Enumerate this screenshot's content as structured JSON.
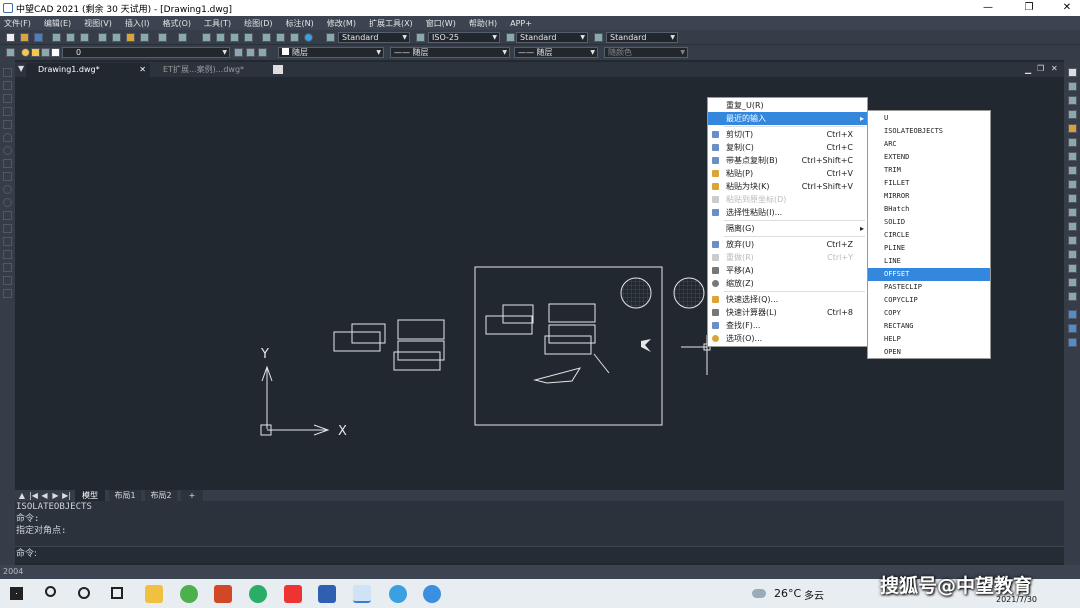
{
  "window": {
    "title": "中望CAD 2021 (剩余 30 天试用) - [Drawing1.dwg]"
  },
  "menu": [
    "文件(F)",
    "编辑(E)",
    "视图(V)",
    "插入(I)",
    "格式(O)",
    "工具(T)",
    "绘图(D)",
    "标注(N)",
    "修改(M)",
    "扩展工具(X)",
    "窗口(W)",
    "帮助(H)",
    "APP+"
  ],
  "toolbar": {
    "text_style": "Standard",
    "dim_style": "ISO-25",
    "table_style": "Standard",
    "multileader_style": "Standard",
    "layer": "0",
    "color": "随层",
    "linetype": "—— 随层",
    "lineweight": "—— 随层",
    "plotstyle": "随颜色"
  },
  "doc_tabs": [
    {
      "label": "Drawing1.dwg*"
    },
    {
      "label": "ET扩展...案例)...dwg*"
    }
  ],
  "layout_tabs": [
    "模型",
    "布局1",
    "布局2",
    "+"
  ],
  "command_history": [
    "ISOLATEOBJECTS",
    "命令:",
    "指定对角点:"
  ],
  "command_prompt": "命令:",
  "status_text": "2004",
  "canvas": {
    "ucs_y": "Y",
    "ucs_x": "X"
  },
  "context_menu": {
    "items": [
      {
        "label": "重复_U(R)",
        "shortcut": "",
        "icon": "",
        "state": ""
      },
      {
        "label": "最近的输入",
        "shortcut": "",
        "icon": "",
        "state": "selected",
        "submenu": true
      },
      {
        "label": "剪切(T)",
        "shortcut": "Ctrl+X",
        "icon": "cut-icon",
        "state": ""
      },
      {
        "label": "复制(C)",
        "shortcut": "Ctrl+C",
        "icon": "copy-icon",
        "state": ""
      },
      {
        "label": "带基点复制(B)",
        "shortcut": "Ctrl+Shift+C",
        "icon": "copy-base-icon",
        "state": ""
      },
      {
        "label": "粘贴(P)",
        "shortcut": "Ctrl+V",
        "icon": "paste-icon",
        "state": ""
      },
      {
        "label": "粘贴为块(K)",
        "shortcut": "Ctrl+Shift+V",
        "icon": "paste-block-icon",
        "state": ""
      },
      {
        "label": "粘贴到原坐标(D)",
        "shortcut": "",
        "icon": "paste-orig-icon",
        "state": "disabled"
      },
      {
        "label": "选择性粘贴(I)...",
        "shortcut": "",
        "icon": "paste-special-icon",
        "state": ""
      },
      {
        "label": "隔离(G)",
        "shortcut": "",
        "icon": "",
        "state": "",
        "submenu": true
      },
      {
        "label": "放弃(U)",
        "shortcut": "Ctrl+Z",
        "icon": "undo-icon",
        "state": ""
      },
      {
        "label": "重做(R)",
        "shortcut": "Ctrl+Y",
        "icon": "redo-icon",
        "state": "disabled"
      },
      {
        "label": "平移(A)",
        "shortcut": "",
        "icon": "pan-icon",
        "state": ""
      },
      {
        "label": "缩放(Z)",
        "shortcut": "",
        "icon": "zoom-icon",
        "state": ""
      },
      {
        "label": "快速选择(Q)...",
        "shortcut": "",
        "icon": "quick-select-icon",
        "state": ""
      },
      {
        "label": "快速计算器(L)",
        "shortcut": "Ctrl+8",
        "icon": "calculator-icon",
        "state": ""
      },
      {
        "label": "查找(F)...",
        "shortcut": "",
        "icon": "find-icon",
        "state": ""
      },
      {
        "label": "选项(O)...",
        "shortcut": "",
        "icon": "options-icon",
        "state": ""
      }
    ]
  },
  "recent_submenu": [
    "U",
    "ISOLATEOBJECTS",
    "ARC",
    "EXTEND",
    "TRIM",
    "FILLET",
    "MIRROR",
    "BHatch",
    "SOLID",
    "CIRCLE",
    "PLINE",
    "LINE",
    "OFFSET",
    "PASTECLIP",
    "COPYCLIP",
    "COPY",
    "RECTANG",
    "HELP",
    "OPEN"
  ],
  "recent_selected": "OFFSET",
  "taskbar": {
    "weather_temp": "26°C",
    "weather_text": "多云",
    "date": "2021/7/30",
    "watermark": "搜狐号@中望教育"
  },
  "colors": {
    "canvas": "#212830",
    "menu_highlight": "#3388dd"
  }
}
